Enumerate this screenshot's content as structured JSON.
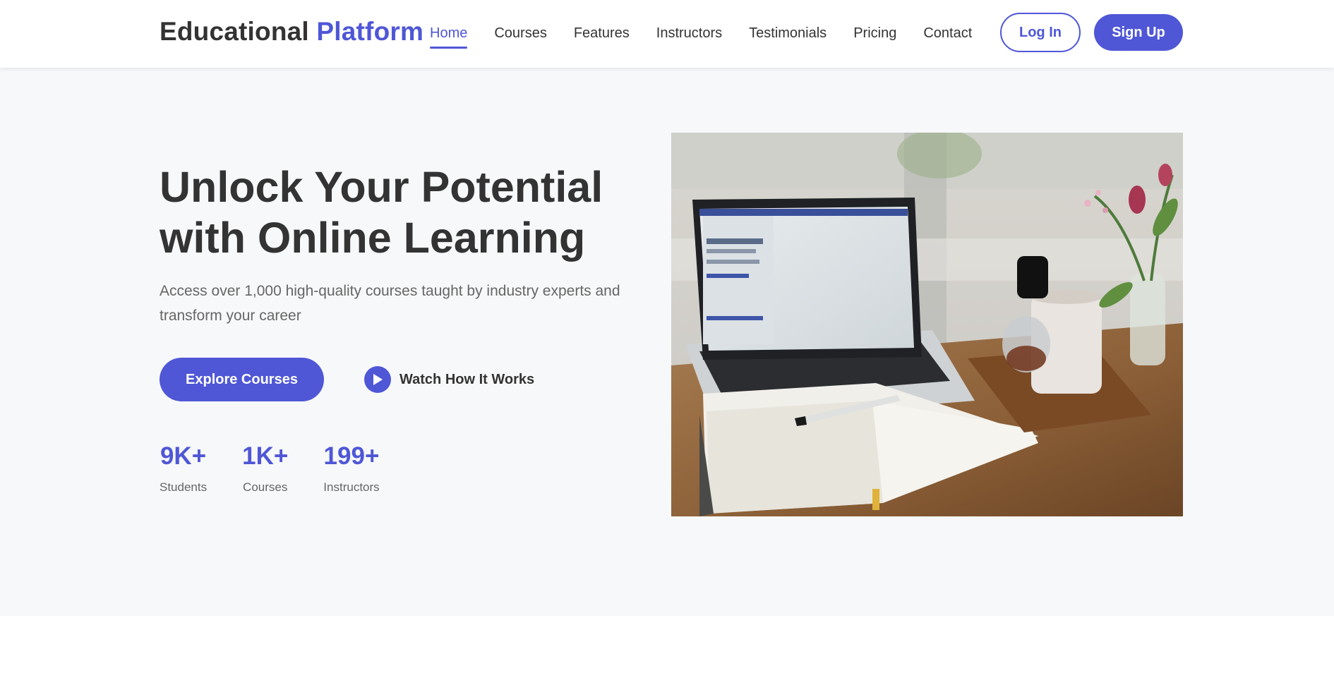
{
  "header": {
    "logo_part1": "Educational",
    "logo_part2": "Platform",
    "nav": [
      {
        "label": "Home",
        "active": true
      },
      {
        "label": "Courses"
      },
      {
        "label": "Features"
      },
      {
        "label": "Instructors"
      },
      {
        "label": "Testimonials"
      },
      {
        "label": "Pricing"
      },
      {
        "label": "Contact"
      }
    ],
    "login_label": "Log In",
    "signup_label": "Sign Up"
  },
  "hero": {
    "title_line1": "Unlock Your Potential",
    "title_line2": "with Online Learning",
    "subtitle": "Access over 1,000 high-quality courses taught by industry experts and transform your career",
    "explore_label": "Explore Courses",
    "watch_label": "Watch How It Works",
    "watch_icon": "play-icon",
    "stats": [
      {
        "value": "9K+",
        "label": "Students"
      },
      {
        "value": "1K+",
        "label": "Courses"
      },
      {
        "value": "199+",
        "label": "Instructors"
      }
    ]
  },
  "colors": {
    "accent": "#4f57d6",
    "text": "#333333",
    "muted": "#666666",
    "hero_bg": "#f7f8fa"
  }
}
